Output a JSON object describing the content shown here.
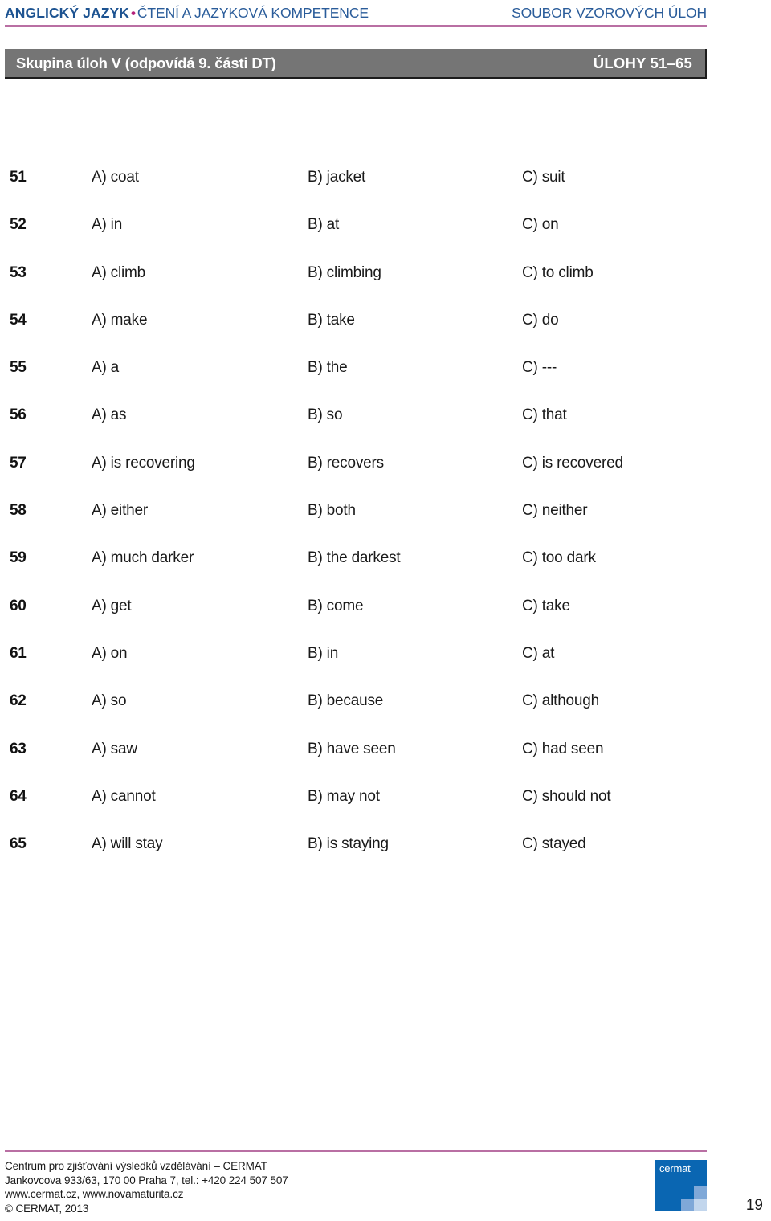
{
  "header": {
    "subject": "ANGLICKÝ JAZYK",
    "bullet": "•",
    "section": "ČTENÍ A JAZYKOVÁ KOMPETENCE",
    "document_type": "SOUBOR VZOROVÝCH ÚLOH",
    "rule_color": "#b96fa3",
    "text_color": "#2a5c9a",
    "bullet_color": "#b4207a"
  },
  "group_bar": {
    "title": "Skupina úloh V (odpovídá 9. části DT)",
    "range": "ÚLOHY 51–65",
    "background": "#757575",
    "text_color": "#ffffff"
  },
  "questions": [
    {
      "number": "51",
      "a": "A) coat",
      "b": "B) jacket",
      "c": "C) suit"
    },
    {
      "number": "52",
      "a": "A) in",
      "b": "B) at",
      "c": "C) on"
    },
    {
      "number": "53",
      "a": "A) climb",
      "b": "B) climbing",
      "c": "C) to climb"
    },
    {
      "number": "54",
      "a": "A) make",
      "b": "B) take",
      "c": "C) do"
    },
    {
      "number": "55",
      "a": "A) a",
      "b": "B) the",
      "c": "C) ---"
    },
    {
      "number": "56",
      "a": "A) as",
      "b": "B) so",
      "c": "C) that"
    },
    {
      "number": "57",
      "a": "A) is recovering",
      "b": "B) recovers",
      "c": "C) is recovered"
    },
    {
      "number": "58",
      "a": "A) either",
      "b": "B) both",
      "c": "C) neither"
    },
    {
      "number": "59",
      "a": "A) much darker",
      "b": "B) the darkest",
      "c": "C) too dark"
    },
    {
      "number": "60",
      "a": "A) get",
      "b": "B) come",
      "c": "C) take"
    },
    {
      "number": "61",
      "a": "A) on",
      "b": "B) in",
      "c": "C) at"
    },
    {
      "number": "62",
      "a": "A) so",
      "b": "B) because",
      "c": "C) although"
    },
    {
      "number": "63",
      "a": "A) saw",
      "b": "B) have seen",
      "c": "C) had seen"
    },
    {
      "number": "64",
      "a": "A) cannot",
      "b": "B) may not",
      "c": "C) should not"
    },
    {
      "number": "65",
      "a": "A) will stay",
      "b": "B) is staying",
      "c": "C) stayed"
    }
  ],
  "footer": {
    "line1": "Centrum pro zjišťování výsledků vzdělávání – CERMAT",
    "line2": "Jankovcova 933/63, 170 00 Praha 7, tel.: +420 224 507 507",
    "line3": "www.cermat.cz, www.novamaturita.cz",
    "line4": "© CERMAT, 2013",
    "logo_text": "cermat",
    "logo_color": "#0a66b2",
    "page_number": "19",
    "rule_color": "#b96fa3"
  }
}
